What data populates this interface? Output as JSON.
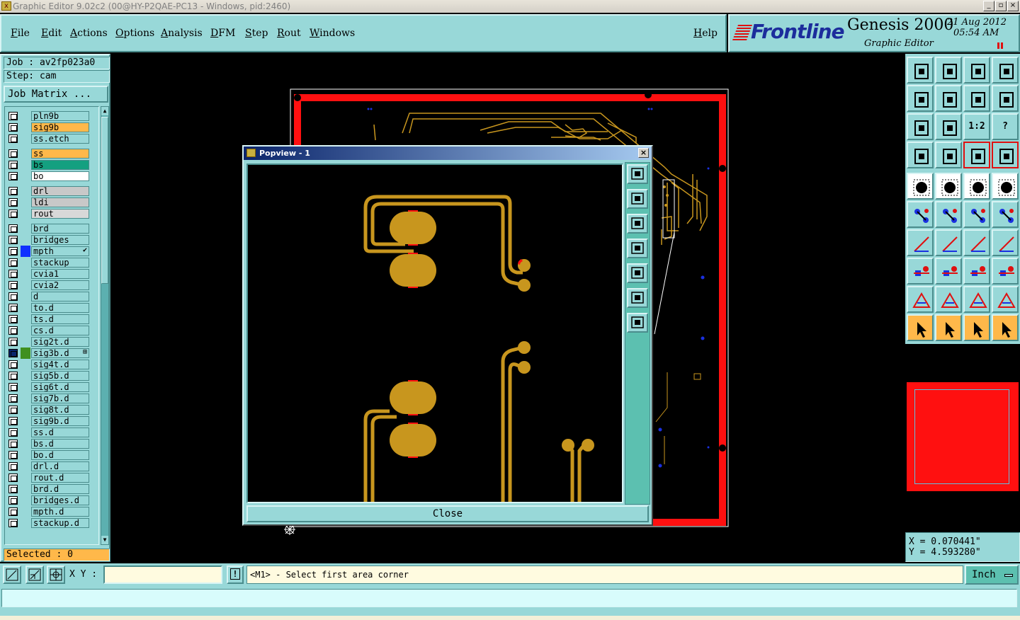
{
  "window": {
    "title": "Graphic Editor 9.02c2 (00@HY-P2QAE-PC13 - Windows, pid:2460)",
    "minimize": "_",
    "maximize": "▫",
    "close": "×"
  },
  "menu": {
    "items": [
      "File",
      "Edit",
      "Actions",
      "Options",
      "Analysis",
      "DFM",
      "Step",
      "Rout",
      "Windows"
    ],
    "help": "Help"
  },
  "branding": {
    "brand": "Frontline",
    "product": "Genesis 2000",
    "subtitle": "Graphic Editor",
    "date": "21 Aug 2012",
    "time": "05:54 AM"
  },
  "job": {
    "job_label": "Job : av2fp023a0",
    "step_label": "Step: cam",
    "matrix_button": "Job Matrix ..."
  },
  "layers": [
    {
      "name": "pln9b",
      "color": "#98d8d8"
    },
    {
      "name": "sig9b",
      "color": "#ffb84a"
    },
    {
      "name": "ss.etch",
      "color": "#98d8d8"
    },
    {
      "name": "ss",
      "color": "#ffb84a"
    },
    {
      "name": "bs",
      "color": "#14a080"
    },
    {
      "name": "bo",
      "color": "#ffffff"
    },
    {
      "name": "drl",
      "color": "#c8c8c8"
    },
    {
      "name": "ldi",
      "color": "#c8c8c8"
    },
    {
      "name": "rout",
      "color": "#d8d8d8"
    },
    {
      "name": "brd",
      "color": "#98d8d8"
    },
    {
      "name": "bridges",
      "color": "#98d8d8"
    },
    {
      "name": "mpth",
      "color": "#98d8d8",
      "affected_color": "#1030ff",
      "mark": "✔"
    },
    {
      "name": "stackup",
      "color": "#98d8d8"
    },
    {
      "name": "cvia1",
      "color": "#98d8d8"
    },
    {
      "name": "cvia2",
      "color": "#98d8d8"
    },
    {
      "name": "d",
      "color": "#98d8d8"
    },
    {
      "name": "to.d",
      "color": "#98d8d8"
    },
    {
      "name": "ts.d",
      "color": "#98d8d8"
    },
    {
      "name": "cs.d",
      "color": "#98d8d8"
    },
    {
      "name": "sig2t.d",
      "color": "#98d8d8"
    },
    {
      "name": "sig3b.d",
      "color": "#98d8d8",
      "affected_color": "#409020",
      "work": true,
      "mark": "⊞"
    },
    {
      "name": "sig4t.d",
      "color": "#98d8d8"
    },
    {
      "name": "sig5b.d",
      "color": "#98d8d8"
    },
    {
      "name": "sig6t.d",
      "color": "#98d8d8"
    },
    {
      "name": "sig7b.d",
      "color": "#98d8d8"
    },
    {
      "name": "sig8t.d",
      "color": "#98d8d8"
    },
    {
      "name": "sig9b.d",
      "color": "#98d8d8"
    },
    {
      "name": "ss.d",
      "color": "#98d8d8"
    },
    {
      "name": "bs.d",
      "color": "#98d8d8"
    },
    {
      "name": "bo.d",
      "color": "#98d8d8"
    },
    {
      "name": "drl.d",
      "color": "#98d8d8"
    },
    {
      "name": "rout.d",
      "color": "#98d8d8"
    },
    {
      "name": "brd.d",
      "color": "#98d8d8"
    },
    {
      "name": "bridges.d",
      "color": "#98d8d8"
    },
    {
      "name": "mpth.d",
      "color": "#98d8d8"
    },
    {
      "name": "stackup.d",
      "color": "#98d8d8"
    }
  ],
  "selected": "Selected : 0",
  "popview": {
    "title": "Popview - 1",
    "close_x": "×",
    "close_button": "Close"
  },
  "tools": {
    "one_to_two": "1:2",
    "help": "?"
  },
  "coords": {
    "x": "X = 0.070441\"",
    "y": "Y = 4.593280\""
  },
  "bottom": {
    "xy_label": "X Y :",
    "xy_value": "",
    "excl": "!",
    "prompt": "<M1> - Select first area corner",
    "unit": "Inch"
  },
  "colors": {
    "panel": "#98d8d8",
    "copper": "#c8961e",
    "board_outline": "#ff1010",
    "highlight": "#ffb84a"
  }
}
